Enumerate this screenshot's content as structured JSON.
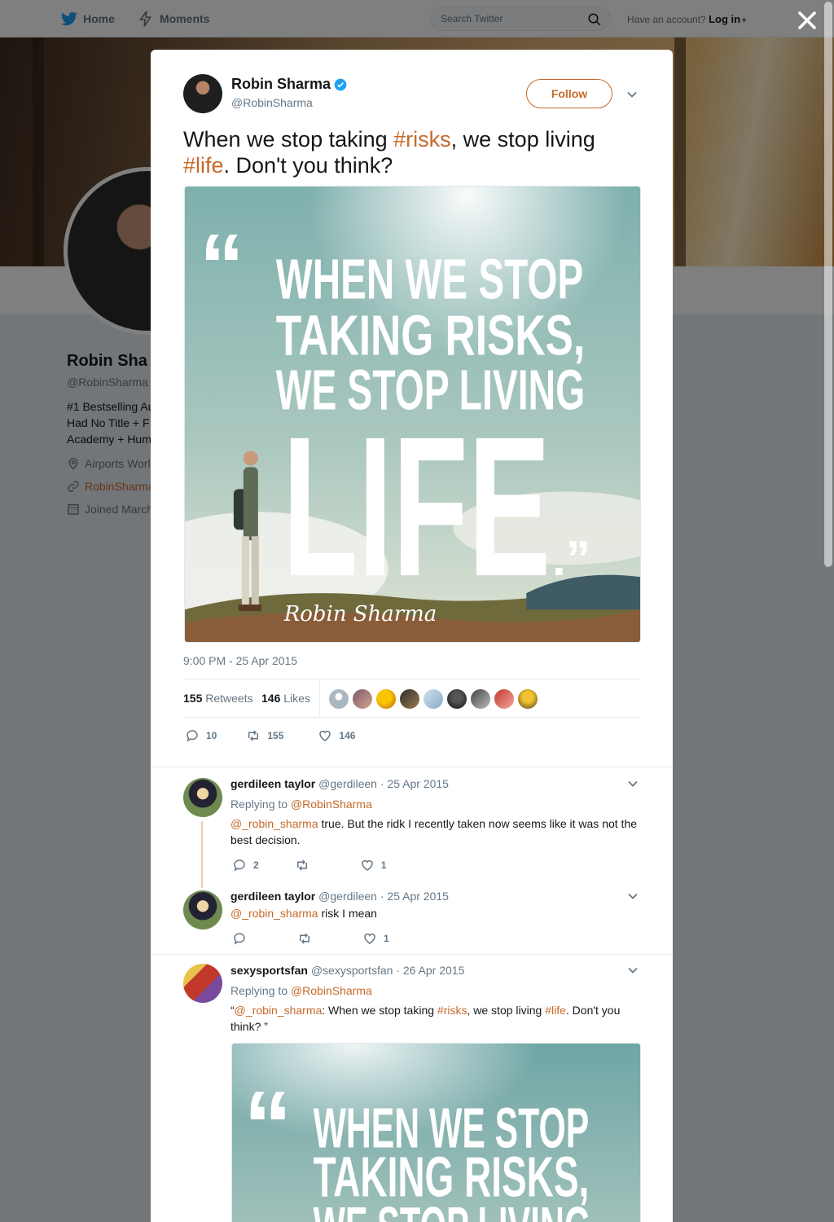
{
  "nav": {
    "home": "Home",
    "moments": "Moments",
    "search_placeholder": "Search Twitter",
    "account_prompt": "Have an account?",
    "login": "Log in"
  },
  "profile": {
    "name": "Robin Sha",
    "handle": "@RobinSharma",
    "bio_lines": [
      "#1 Bestselling Au",
      "Had No Title + F",
      "Academy + Hum"
    ],
    "location": "Airports Worl",
    "link": "RobinSharma",
    "joined": "Joined March"
  },
  "tweet": {
    "author_name": "Robin Sharma",
    "author_handle": "@RobinSharma",
    "follow_label": "Follow",
    "text_1": "When we stop taking ",
    "tag_risks": "#risks",
    "text_2": ", we stop living ",
    "tag_life": "#life",
    "text_3": ". Don't you think?",
    "timestamp": "9:00 PM - 25 Apr 2015",
    "retweets_count": "155",
    "retweets_label": "Retweets",
    "likes_count": "146",
    "likes_label": "Likes",
    "reply_count": "10",
    "retweet_count": "155",
    "like_count": "146"
  },
  "quote_image": {
    "open_quote": "“",
    "line1": "WHEN WE STOP",
    "line2": "TAKING RISKS,",
    "line3": "WE STOP LIVING",
    "big": "LIFE",
    "close_quote": ".”",
    "signature": "Robin Sharma"
  },
  "replies": [
    {
      "name": "gerdileen taylor",
      "handle": "@gerdileen",
      "date": "· 25 Apr 2015",
      "replying_label": "Replying to",
      "replying_to": "@RobinSharma",
      "mention": "@_robin_sharma",
      "text": " true. But the ridk I recently taken now seems like it was not the best decision.",
      "replies": "2",
      "likes": "1"
    },
    {
      "name": "gerdileen taylor",
      "handle": "@gerdileen",
      "date": "· 25 Apr 2015",
      "mention": "@_robin_sharma",
      "text": " risk I mean",
      "likes": "1"
    },
    {
      "name": "sexysportsfan",
      "handle": "@sexysportsfan",
      "date": "· 26 Apr 2015",
      "replying_label": "Replying to",
      "replying_to": "@RobinSharma",
      "quote_open": "“",
      "mention": "@_robin_sharma",
      "text_1": ": When we stop taking ",
      "tag_risks": "#risks",
      "text_2": ", we stop living ",
      "tag_life": "#life",
      "text_3": ". Don't you think? ”"
    }
  ],
  "colors": {
    "accent": "#c5692b",
    "verified": "#1da1f2",
    "text_secondary": "#657786"
  }
}
